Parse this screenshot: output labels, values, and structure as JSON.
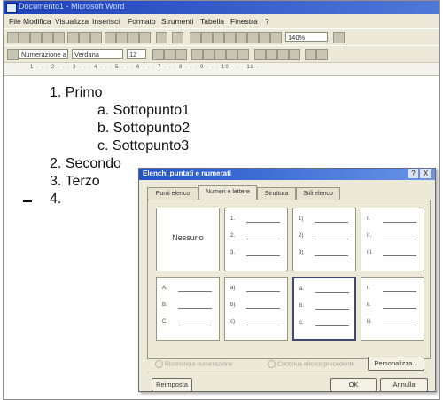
{
  "window": {
    "title": "Documento1 - Microsoft Word"
  },
  "menu": [
    "File",
    "Modifica",
    "Visualizza",
    "Inserisci",
    "Formato",
    "Strumenti",
    "Tabella",
    "Finestra",
    "?"
  ],
  "formatting": {
    "style": "Numerazione a",
    "font": "Verdana",
    "size": "12",
    "zoom": "140%"
  },
  "ruler": {
    "marks": "1 · · · 2 · · · 3 · · · 4 · · · 5 · · · 6 · · · 7 · · · 8 · · · 9 · · · 10 · · · 11 · ·"
  },
  "document": {
    "items": [
      "1. Primo",
      "a. Sottopunto1",
      "b. Sottopunto2",
      "c. Sottopunto3",
      "2. Secondo",
      "3. Terzo",
      "4."
    ]
  },
  "dialog": {
    "title": "Elenchi puntati e numerati",
    "help": "?",
    "close": "X",
    "tabs": [
      "Punti elenco",
      "Numeri e lettere",
      "Struttura",
      "Stili elenco"
    ],
    "active_tab": "Numeri e lettere",
    "none_label": "Nessuno",
    "styles": [
      [
        "1.",
        "2.",
        "3."
      ],
      [
        "1)",
        "2)",
        "3)"
      ],
      [
        "I.",
        "II.",
        "III."
      ],
      [
        "A.",
        "B.",
        "C."
      ],
      [
        "a)",
        "b)",
        "c)"
      ],
      [
        "a.",
        "b.",
        "c."
      ],
      [
        "i.",
        "ii.",
        "iii."
      ]
    ],
    "selected_style": "a.",
    "restart_label": "Ricomincia numerazione",
    "continue_label": "Continua elenco precedente",
    "customize_label": "Personalizza...",
    "reset_label": "Reimposta",
    "ok_label": "OK",
    "cancel_label": "Annulla"
  }
}
